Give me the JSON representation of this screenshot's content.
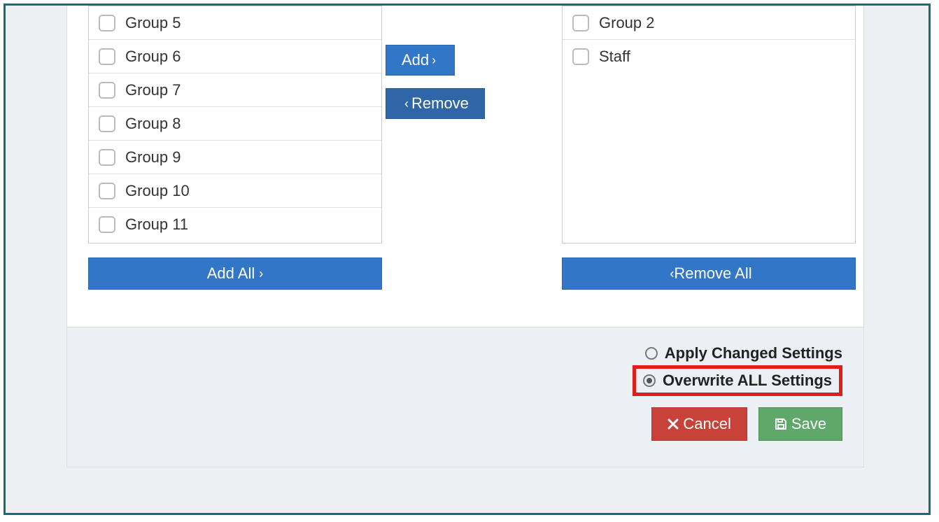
{
  "left_list": {
    "items": [
      {
        "label": "Group 5"
      },
      {
        "label": "Group 6"
      },
      {
        "label": "Group 7"
      },
      {
        "label": "Group 8"
      },
      {
        "label": "Group 9"
      },
      {
        "label": "Group 10"
      },
      {
        "label": "Group 11"
      }
    ]
  },
  "right_list": {
    "items": [
      {
        "label": "Group 2"
      },
      {
        "label": "Staff"
      }
    ]
  },
  "buttons": {
    "add": "Add",
    "remove": "Remove",
    "add_all": "Add All",
    "remove_all": "Remove All",
    "cancel": "Cancel",
    "save": "Save"
  },
  "radios": {
    "apply_changed": "Apply Changed Settings",
    "overwrite_all": "Overwrite ALL Settings",
    "selected": "overwrite_all"
  }
}
